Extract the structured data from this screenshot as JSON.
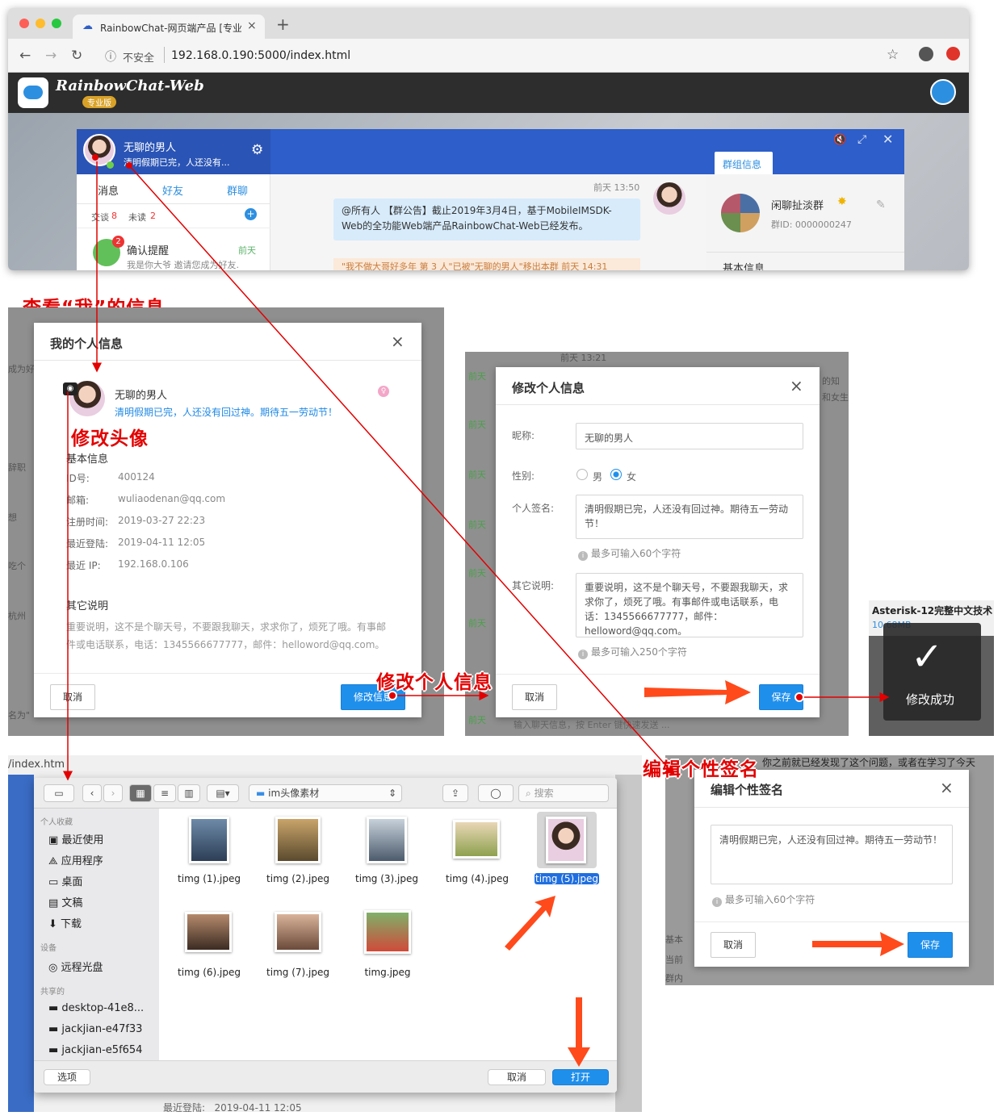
{
  "browser": {
    "tab_title": "RainbowChat-网页端产品 [专业",
    "tab_close": "×",
    "new_tab": "+",
    "security": "不安全",
    "url": "192.168.0.190:5000/index.html",
    "app_logo": "RainbowChat-Web",
    "app_edition": "专业版"
  },
  "chat": {
    "user_name": "无聊的男人",
    "user_signature": "清明假期已完，人还没有...",
    "tabs": [
      "消息",
      "好友",
      "群聊"
    ],
    "counts": {
      "chat_label": "交谈",
      "chat_count": "8",
      "unread_label": "未读",
      "unread_count": "2"
    },
    "notice_title": "确认提醒",
    "notice_badge": "2",
    "notice_time": "前天",
    "notice_text": "我是你大爷 邀请您成为好友.",
    "msg_time": "前天 13:50",
    "msg_text": "@所有人 【群公告】截止2019年3月4日，基于MobileIMSDK-Web的全功能Web端产品RainbowChat-Web已经发布。",
    "sys_msg": "\"我不做大哥好多年 第 3 人\"已被\"无聊的男人\"移出本群 前天 14:31",
    "group_tab": "群组信息",
    "group_name": "闲聊扯淡群",
    "group_id": "群ID: 0000000247",
    "group_section": "基本信息"
  },
  "annotations": {
    "view_me": "查看“我”的信息",
    "change_avatar": "修改头像",
    "edit_profile": "修改个人信息",
    "edit_signature": "编辑个性签名"
  },
  "my_info": {
    "title": "我的个人信息",
    "close": "×",
    "name": "无聊的男人",
    "signature": "清明假期已完，人还没有回过神。期待五一劳动节！",
    "basic_title": "基本信息",
    "fields": [
      {
        "label": "ID号:",
        "value": "400124"
      },
      {
        "label": "邮箱:",
        "value": "wuliaodenan@qq.com"
      },
      {
        "label": "注册时间:",
        "value": "2019-03-27 22:23"
      },
      {
        "label": "最近登陆:",
        "value": "2019-04-11 12:05"
      },
      {
        "label": "最近 IP:",
        "value": "192.168.0.106"
      }
    ],
    "other_title": "其它说明",
    "other_text": "重要说明，这不是个聊天号，不要跟我聊天，求求你了，烦死了哦。有事邮件或电话联系，电话：1345566677777，邮件：helloword@qq.com。",
    "cancel": "取消",
    "edit_btn": "修改信息",
    "bg_left": [
      "成为好",
      "辞职",
      "想",
      "吃个",
      "杭州",
      "名为\""
    ]
  },
  "edit_info": {
    "title": "修改个人信息",
    "close": "×",
    "bg_time": "前天 13:21",
    "nickname_label": "昵称:",
    "nickname": "无聊的男人",
    "gender_label": "性别:",
    "male": "男",
    "female": "女",
    "sign_label": "个人签名:",
    "sign": "清明假期已完，人还没有回过神。期待五一劳动节！",
    "sign_hint": "最多可输入60个字符",
    "other_label": "其它说明:",
    "other": "重要说明，这不是个聊天号，不要跟我聊天，求求你了，烦死了哦。有事邮件或电话联系，电话：1345566677777，邮件：helloword@qq.com。",
    "other_hint": "最多可输入250个字符",
    "cancel": "取消",
    "save": "保存",
    "bg_left": [
      "前天",
      "前天",
      "前天",
      "前天",
      "前天",
      "前天",
      "前天"
    ],
    "bg_right": [
      "的知",
      "和女生"
    ],
    "bg_bottom": "输入聊天信息，按 Enter 键快速发送 ..."
  },
  "toast": {
    "header": "Asterisk-12完整中文技术",
    "size": "10.68MB",
    "text": "修改成功"
  },
  "finder": {
    "bg_url": "/index.htm",
    "folder": "im头像素材",
    "search": "搜索",
    "sections": [
      "个人收藏",
      "设备",
      "共享的"
    ],
    "favorites": [
      "最近使用",
      "应用程序",
      "桌面",
      "文稿",
      "下载"
    ],
    "devices": [
      "远程光盘"
    ],
    "shared": [
      "desktop-41e8...",
      "jackjian-e47f33",
      "jackjian-e5f654"
    ],
    "files": [
      "timg (1).jpeg",
      "timg (2).jpeg",
      "timg (3).jpeg",
      "timg (4).jpeg",
      "timg (5).jpeg",
      "timg (6).jpeg",
      "timg (7).jpeg",
      "timg.jpeg"
    ],
    "options": "选项",
    "cancel": "取消",
    "open": "打开",
    "bg_footer": "最近登陆:   2019-04-11 12:05"
  },
  "signature_dialog": {
    "bg_text": "你之前就已经发现了这个问题，或者在学习了今天",
    "title": "编辑个性签名",
    "close": "×",
    "text": "清明假期已完，人还没有回过神。期待五一劳动节！",
    "hint": "最多可输入60个字符",
    "cancel": "取消",
    "save": "保存",
    "bg_left": [
      "基本",
      "当前",
      "群内",
      "群创",
      "建群",
      "本群",
      "截止"
    ]
  },
  "colors": {
    "brand": "#2d5ec9",
    "primary": "#1f8fec",
    "annotation": "#e30000"
  }
}
